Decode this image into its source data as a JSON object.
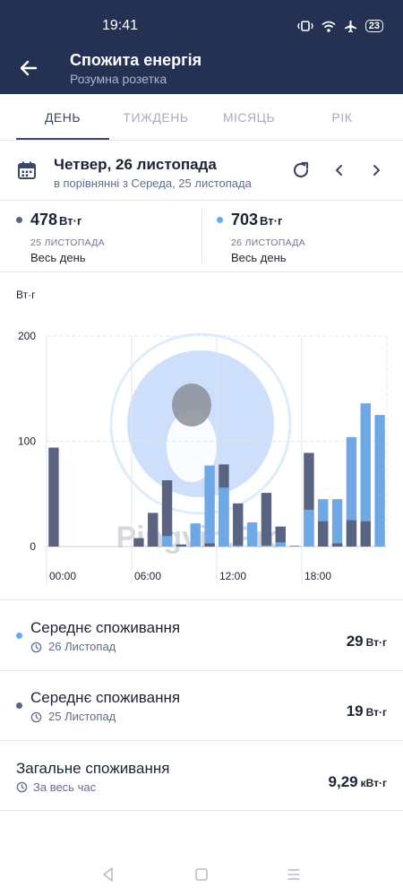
{
  "status_bar": {
    "time": "19:41",
    "battery": "23"
  },
  "header": {
    "title": "Спожита енергія",
    "subtitle": "Розумна розетка"
  },
  "tabs": [
    {
      "label": "ДЕНЬ",
      "active": true
    },
    {
      "label": "ТИЖДЕНЬ",
      "active": false
    },
    {
      "label": "МІСЯЦЬ",
      "active": false
    },
    {
      "label": "РІК",
      "active": false
    }
  ],
  "date": {
    "main": "Четвер, 26 листопада",
    "compare": "в порівнянні з Середа, 25 листопада"
  },
  "totals": [
    {
      "value": "478",
      "unit": "Вт·г",
      "date": "25 ЛИСТОПАДА",
      "period": "Весь день",
      "color": "#5a6482"
    },
    {
      "value": "703",
      "unit": "Вт·г",
      "date": "26 ЛИСТОПАДА",
      "period": "Весь день",
      "color": "#6ea8e6"
    }
  ],
  "chart_data": {
    "type": "bar",
    "unit_label": "Вт·г",
    "y_ticks": [
      "200",
      "100",
      "0"
    ],
    "ylim": [
      0,
      200
    ],
    "x_tick_labels": [
      "00:00",
      "06:00",
      "12:00",
      "18:00"
    ],
    "grid": true,
    "series": [
      {
        "date": "25 листопада",
        "color": "#5a6482",
        "values": [
          94,
          0,
          0,
          0,
          0,
          0,
          8,
          32,
          63,
          2,
          0,
          3,
          78,
          41,
          0,
          51,
          19,
          0,
          89,
          24,
          3,
          25,
          24,
          0
        ]
      },
      {
        "date": "26 листопада",
        "color": "#6ea8e6",
        "values": [
          0,
          0,
          0,
          0,
          0,
          0,
          0,
          0,
          10,
          0,
          22,
          77,
          56,
          1,
          23,
          1,
          4,
          1,
          35,
          45,
          45,
          104,
          136,
          125
        ]
      }
    ]
  },
  "watermark": "Pingvin.Pro",
  "summary": [
    {
      "title": "Середнє споживання",
      "sub": "26 Листопад",
      "value": "29",
      "unit": "Вт·г",
      "dot_color": "#6ea8e6"
    },
    {
      "title": "Середнє споживання",
      "sub": "25 Листопад",
      "value": "19",
      "unit": "Вт·г",
      "dot_color": "#5a6482"
    },
    {
      "title": "Загальне споживання",
      "sub": "За весь час",
      "value": "9,29",
      "unit": "кВт·г",
      "dot_color": ""
    }
  ]
}
